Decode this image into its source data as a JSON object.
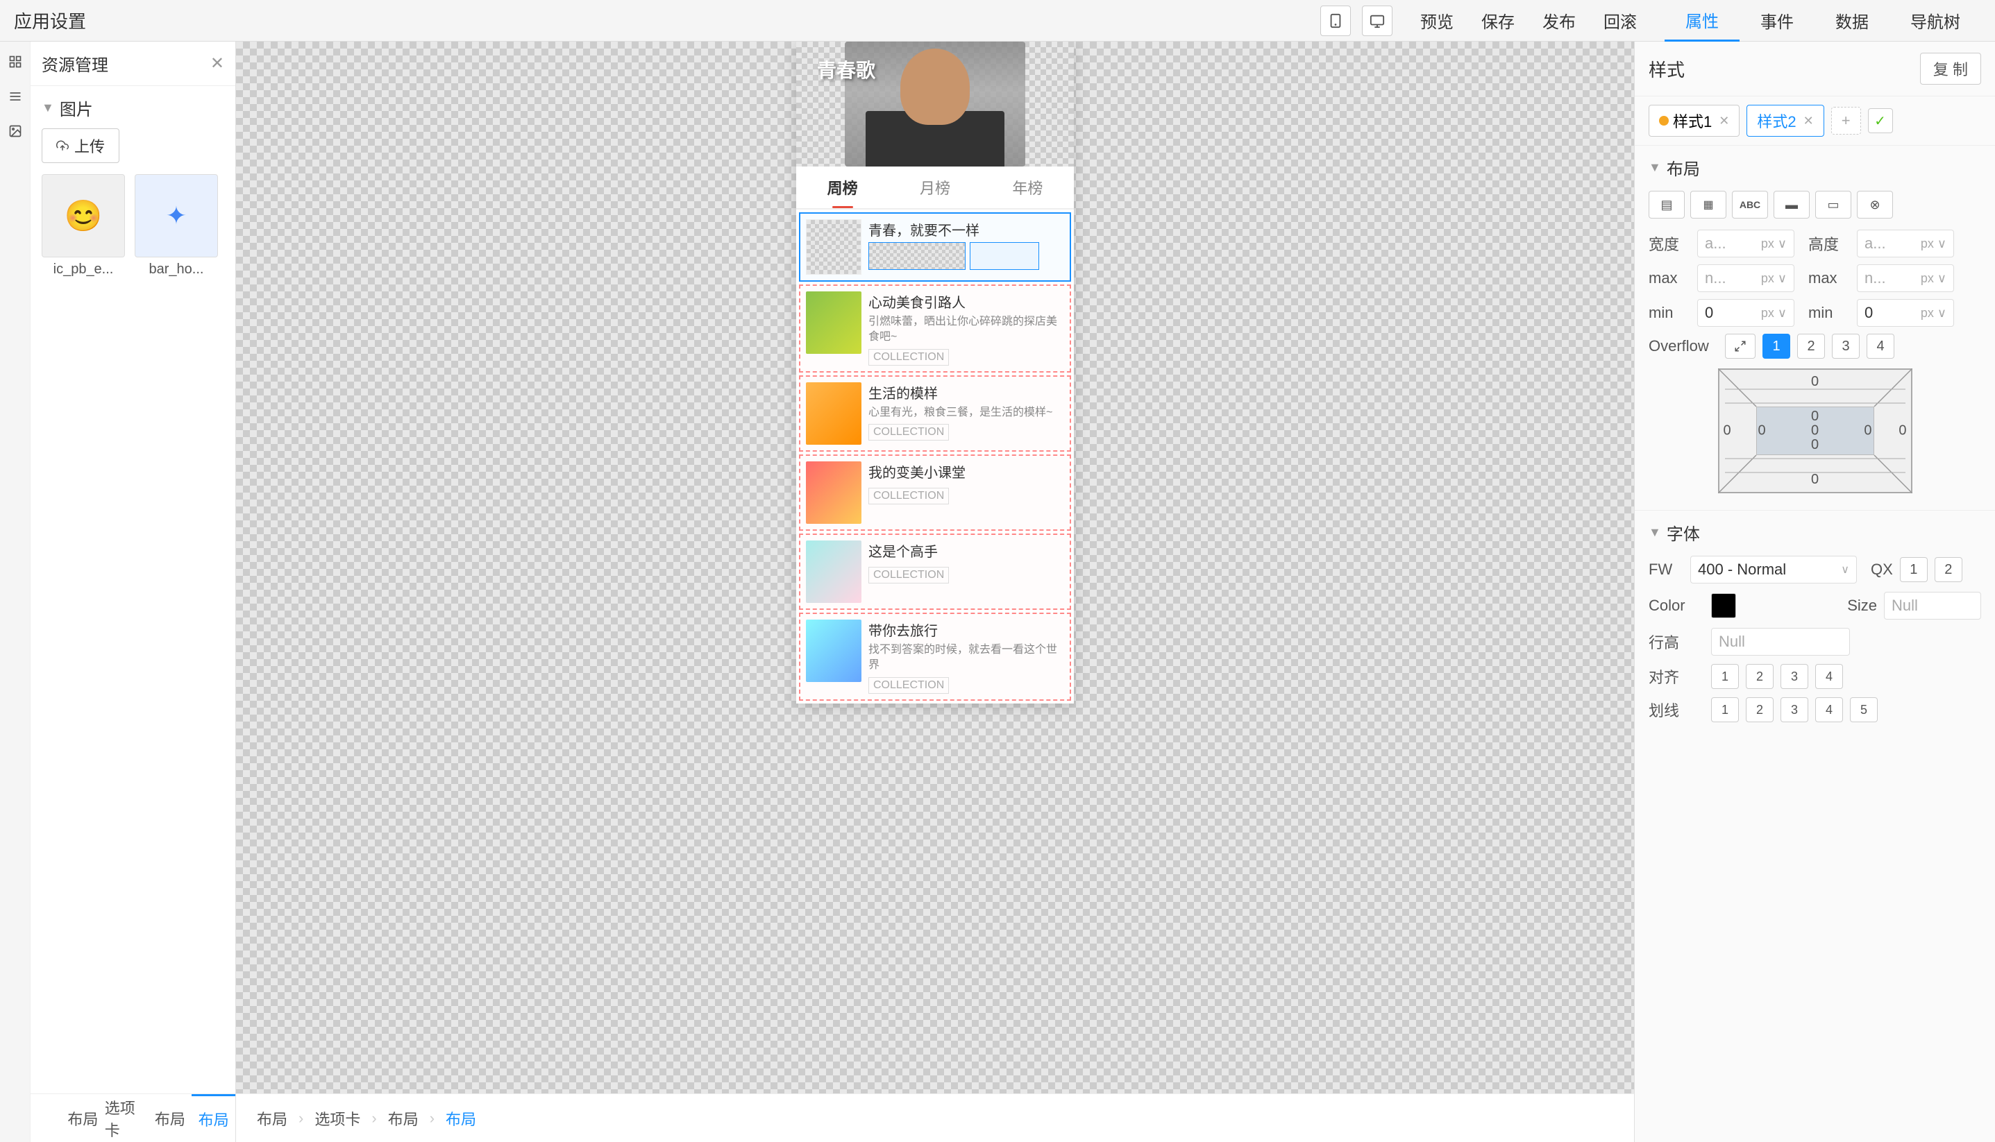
{
  "app": {
    "title": "应用设置"
  },
  "topbar": {
    "icons": [
      "mobile-icon",
      "desktop-icon"
    ],
    "actions": [
      "preview",
      "save",
      "publish",
      "rollback"
    ],
    "action_labels": [
      "预览",
      "保存",
      "发布",
      "回滚"
    ],
    "tabs": [
      "属性",
      "事件",
      "数据",
      "导航树"
    ],
    "active_tab": "属性"
  },
  "sidebar": {
    "title": "资源管理",
    "sections": [
      {
        "name": "图片",
        "items": [
          {
            "id": "ic_pb_e",
            "label": "ic_pb_e...",
            "icon": "😊"
          },
          {
            "id": "bar_ho",
            "label": "bar_ho...",
            "icon": "✦"
          }
        ]
      }
    ],
    "upload_btn": "上传"
  },
  "bottom_nav": {
    "items": [
      "布局",
      "选项卡",
      "布局",
      "布局"
    ],
    "labels": [
      "布局",
      "选项卡",
      "布局",
      "布局"
    ],
    "active": "布局"
  },
  "canvas": {
    "phone": {
      "tabs": [
        "周榜",
        "月榜",
        "年榜"
      ],
      "active_tab": "周榜",
      "list_items": [
        {
          "title": "青春，就要不一样",
          "desc": "",
          "collection": "",
          "selected": true
        },
        {
          "title": "心动美食引路人",
          "desc": "引燃味蕾，晒出让你心碎碎跳的探店美食吧~",
          "collection": "COLLECTION"
        },
        {
          "title": "生活的模样",
          "desc": "心里有光，粮食三餐，是生活的模样~",
          "collection": "COLLECTION"
        },
        {
          "title": "我的变美小课堂",
          "desc": "",
          "collection": "COLLECTION"
        },
        {
          "title": "这是个高手",
          "desc": "",
          "collection": "COLLECTION"
        },
        {
          "title": "带你去旅行",
          "desc": "找不到答案的时候，就去看一看这个世界",
          "collection": "COLLECTION"
        }
      ]
    }
  },
  "right_panel": {
    "style_section_title": "样式",
    "copy_btn": "复 制",
    "style_tabs": [
      {
        "label": "样式1",
        "active": true,
        "dot_color": "#f5a623"
      },
      {
        "label": "样式2",
        "active": false,
        "dot_color": null
      }
    ],
    "layout_section": {
      "title": "布局",
      "layout_buttons": [
        {
          "icon": "▤",
          "active": false
        },
        {
          "icon": "▦",
          "active": false
        },
        {
          "icon": "ABC",
          "active": false
        },
        {
          "icon": "▬",
          "active": false
        },
        {
          "icon": "▭",
          "active": false
        },
        {
          "icon": "⊗",
          "active": false
        }
      ],
      "width_label": "宽度",
      "width_value": "a...",
      "width_unit": "px",
      "height_label": "高度",
      "height_value": "a...",
      "height_unit": "px",
      "max_label": "max",
      "max_w_value": "n...",
      "max_w_unit": "px",
      "max_h_value": "n...",
      "max_h_unit": "px",
      "min_label": "min",
      "min_w_value": "0",
      "min_w_unit": "px",
      "min_h_value": "0",
      "min_h_unit": "px",
      "overflow_label": "Overflow",
      "overflow_options": [
        "1",
        "2",
        "3",
        "4"
      ],
      "overflow_active": "1",
      "padding": {
        "top": "0",
        "right": "0",
        "bottom": "0",
        "left": "0",
        "center": "0"
      }
    },
    "font_section": {
      "title": "字体",
      "fw_label": "FW",
      "fw_value": "400 - Normal",
      "qx_label": "QX",
      "qx_1": "1",
      "qx_2": "2",
      "color_label": "Color",
      "color_value": "#000000",
      "size_label": "Size",
      "size_value": "Null",
      "lineh_label": "行高",
      "lineh_value": "Null",
      "align_label": "对齐",
      "align_options": [
        "1",
        "2",
        "3",
        "4"
      ],
      "underline_label": "划线",
      "underline_options": [
        "1",
        "2",
        "3",
        "4",
        "5"
      ]
    }
  },
  "breadcrumb": {
    "items": [
      "布局",
      "选项卡",
      "布局",
      "布局"
    ],
    "active": "布局"
  }
}
